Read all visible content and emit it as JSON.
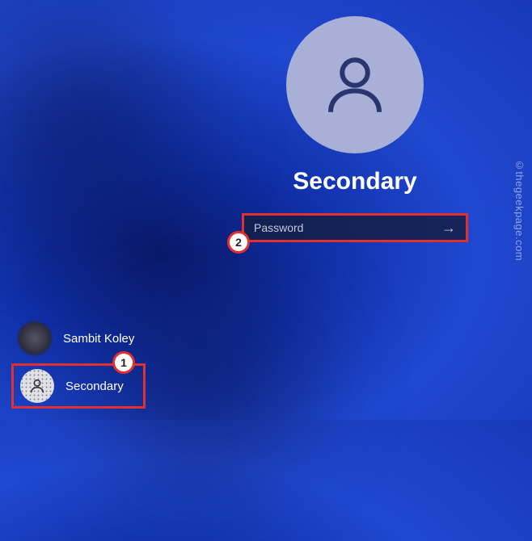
{
  "watermark": "©thegeekpage.com",
  "main_user": "Secondary",
  "password_placeholder": "Password",
  "users": [
    {
      "name": "Sambit Koley"
    },
    {
      "name": "Secondary"
    }
  ],
  "callouts": {
    "step1": "1",
    "step2": "2"
  }
}
